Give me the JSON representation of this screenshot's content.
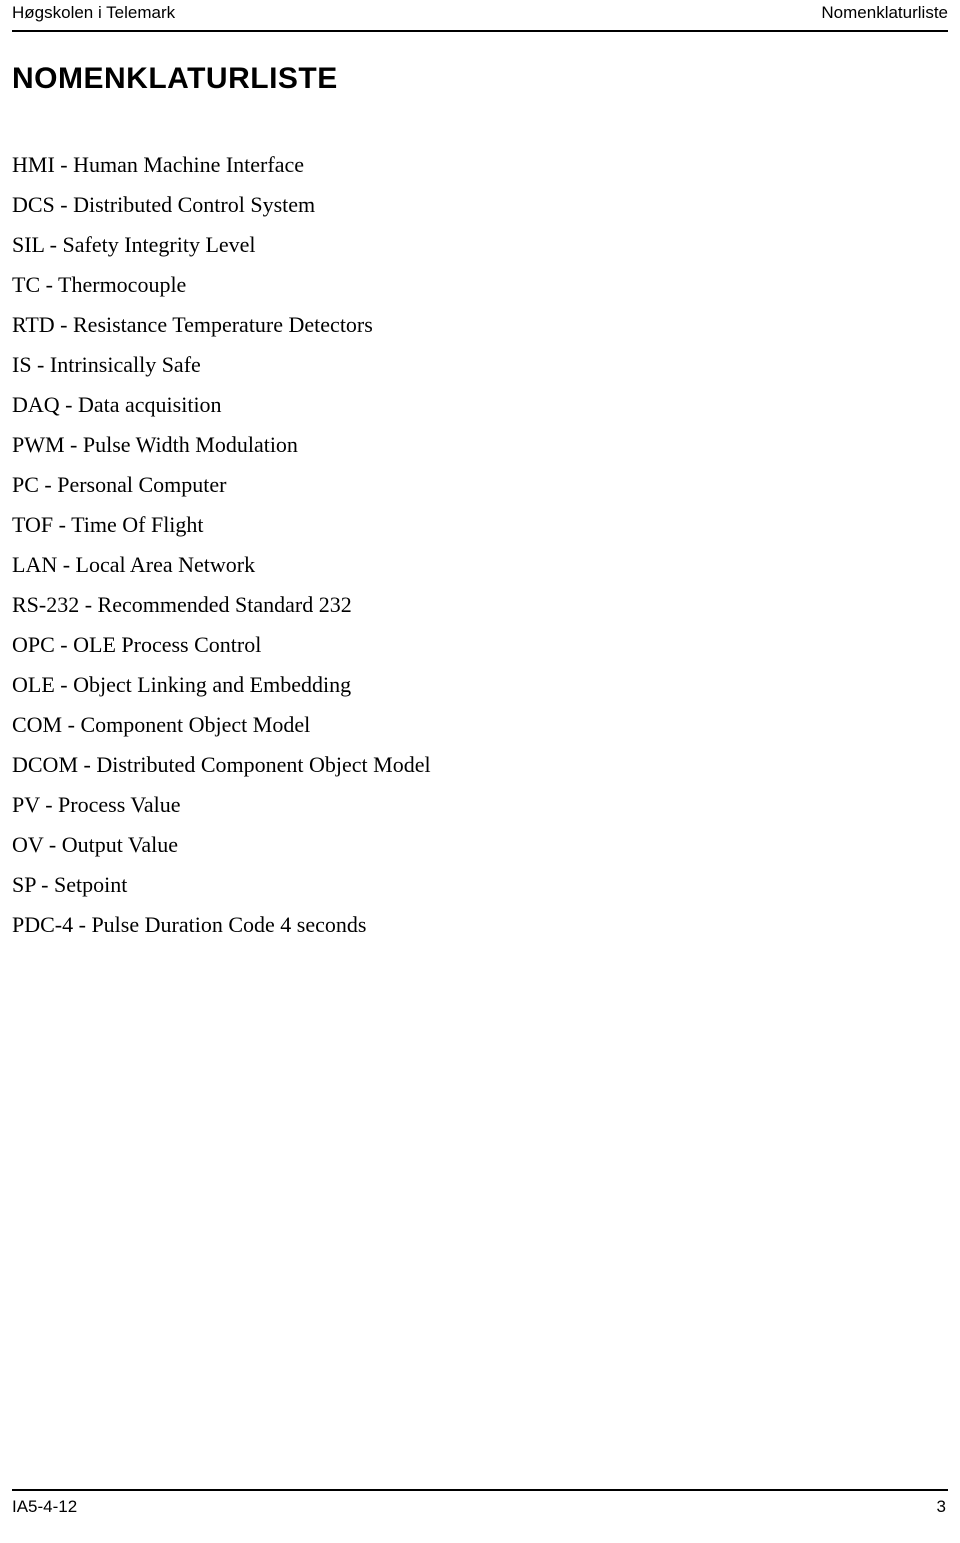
{
  "header": {
    "left": "Høgskolen i Telemark",
    "right": "Nomenklaturliste"
  },
  "title": "NOMENKLATURLISTE",
  "nomenclature": {
    "items": [
      "HMI - Human Machine Interface",
      "DCS - Distributed Control System",
      "SIL - Safety Integrity Level",
      "TC - Thermocouple",
      "RTD - Resistance Temperature Detectors",
      "IS - Intrinsically Safe",
      "DAQ - Data acquisition",
      "PWM - Pulse Width Modulation",
      "PC - Personal Computer",
      "TOF - Time Of Flight",
      "LAN - Local Area Network",
      "RS-232 - Recommended Standard 232",
      "OPC - OLE Process Control",
      "OLE - Object Linking and Embedding",
      "COM - Component Object Model",
      "DCOM - Distributed Component Object Model",
      "PV - Process Value",
      "OV - Output Value",
      "SP - Setpoint",
      "PDC-4 - Pulse Duration Code 4 seconds"
    ]
  },
  "footer": {
    "left": "IA5-4-12",
    "right": "3"
  },
  "colors": {
    "text": "#000000",
    "background": "#ffffff",
    "rule": "#000000"
  }
}
